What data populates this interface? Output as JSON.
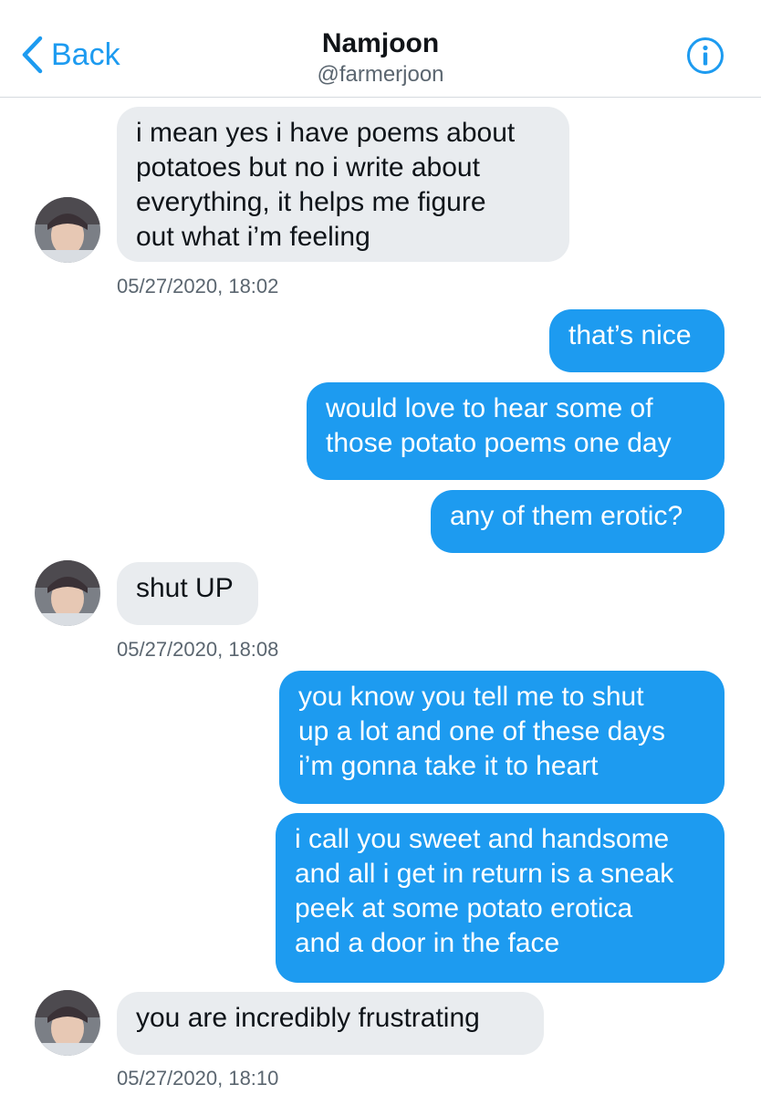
{
  "header": {
    "back_label": "Back",
    "name": "Namjoon",
    "handle": "@farmerjoon"
  },
  "messages": [
    {
      "from": "them",
      "text": "i mean yes i have poems about\npotatoes but no i write about\neverything, it helps me figure\nout what i’m feeling"
    },
    {
      "timestamp": "05/27/2020, 18:02"
    },
    {
      "from": "me",
      "text": "that’s nice"
    },
    {
      "from": "me",
      "text": "would love to hear some of\nthose potato poems one day"
    },
    {
      "from": "me",
      "text": "any of them erotic?"
    },
    {
      "from": "them",
      "text": "shut UP"
    },
    {
      "timestamp": "05/27/2020, 18:08"
    },
    {
      "from": "me",
      "text": "you know you tell me to shut\nup a lot and one of these days\ni’m gonna take it to heart"
    },
    {
      "from": "me",
      "text": "i call you sweet and handsome\nand all i get in return is a sneak\npeek at some potato erotica\nand a door in the face"
    },
    {
      "from": "them",
      "text": "you are incredibly frustrating"
    },
    {
      "timestamp": "05/27/2020, 18:10"
    }
  ],
  "colors": {
    "accent": "#1d9bf0",
    "incoming_bubble": "#e9ecef",
    "timestamp": "#5b6670"
  },
  "icons": {
    "back": "chevron-left-icon",
    "info": "info-circle-icon"
  }
}
